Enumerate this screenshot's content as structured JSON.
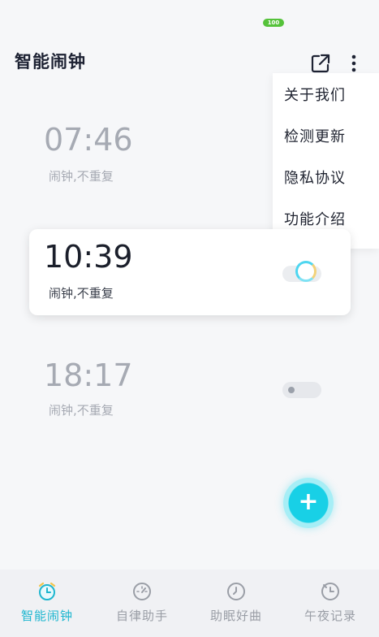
{
  "status": {
    "battery": "100"
  },
  "header": {
    "title": "智能闹钟"
  },
  "menu": {
    "items": [
      "关于我们",
      "检测更新",
      "隐私协议",
      "功能介绍"
    ]
  },
  "alarms": [
    {
      "time": "07:46",
      "repeat": "闹钟,不重复",
      "enabled": false
    },
    {
      "time": "10:39",
      "repeat": "闹钟,不重复",
      "enabled": true
    },
    {
      "time": "18:17",
      "repeat": "闹钟,不重复",
      "enabled": false
    }
  ],
  "fab": {
    "label": "+"
  },
  "nav": {
    "items": [
      {
        "label": "智能闹钟",
        "icon": "alarm-clock-icon",
        "active": true
      },
      {
        "label": "自律助手",
        "icon": "gauge-icon",
        "active": false
      },
      {
        "label": "助眠好曲",
        "icon": "clock-icon",
        "active": false
      },
      {
        "label": "午夜记录",
        "icon": "moon-clock-icon",
        "active": false
      }
    ]
  },
  "colors": {
    "accent": "#1db6cf",
    "battery": "#55c23a",
    "inactive_text": "#a6aab3"
  }
}
